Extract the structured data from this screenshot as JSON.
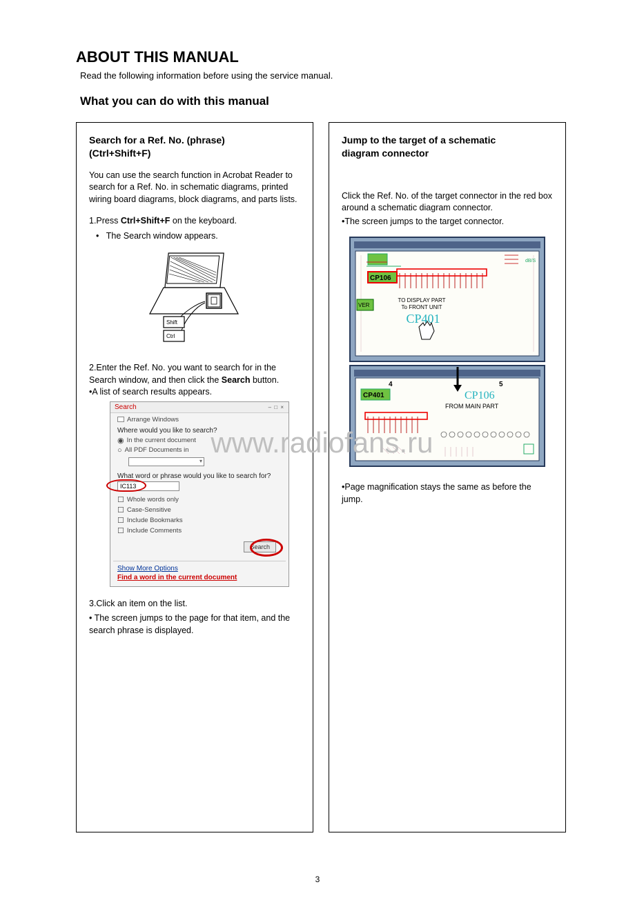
{
  "title": "ABOUT THIS MANUAL",
  "intro": "Read the following information before using the service manual.",
  "subtitle": "What you can do with this manual",
  "left": {
    "heading_l1": "Search for a Ref. No. (phrase)",
    "heading_l2": "(Ctrl+Shift+F)",
    "para1": "You can use the search function in Acrobat Reader to search for a Ref. No. in schematic diagrams, printed wiring board diagrams, block diagrams, and parts lists.",
    "step1_a": "1.Press ",
    "step1_b": "Ctrl+Shift+F",
    "step1_c": " on the keyboard.",
    "step1_bullet": "The Search window appears.",
    "laptop_key_top": "Shift",
    "laptop_key_bottom": "Ctrl",
    "step2a": "2.Enter the Ref. No. you want to search for in the Search window, and then click the ",
    "step2b": "Search",
    "step2c": " button.",
    "step2_bullet": "•A list of search results appears.",
    "searchbox": {
      "title": "Search",
      "arrange": "Arrange Windows",
      "where": "Where would you like to search?",
      "opt_current": "In the current document",
      "opt_all": "All PDF Documents in",
      "dd_arrow": "▾",
      "what": "What word or phrase would you like to search for?",
      "input_value": "IC113",
      "cb1": "Whole words only",
      "cb2": "Case-Sensitive",
      "cb3": "Include Bookmarks",
      "cb4": "Include Comments",
      "btn": "Search",
      "link1": "Show More Options",
      "link2": "Find a word in the current document"
    },
    "step3": "3.Click an item on the list.",
    "step3_bullet": "• The screen jumps to the page for that item, and the search phrase is displayed."
  },
  "right": {
    "heading_l1": "Jump to the target of a schematic",
    "heading_l2": "diagram connector",
    "para1": "Click the Ref. No. of the target connector in the red box around a schematic diagram connector.",
    "bullet1": "•The screen jumps to the target connector.",
    "bullet2": "•Page magnification stays the same as before the jump.",
    "schem": {
      "cp106": "CP106",
      "ver": "VER",
      "to_display1": "TO DISPLAY PART",
      "to_display2": "To FRONT UNIT",
      "cp401_green": "CP401",
      "cp401_cyan": "CP401",
      "axis_4": "4",
      "axis_5": "5",
      "cp106_cyan": "CP106",
      "from_main": "FROM MAIN PART"
    }
  },
  "watermark": "www.radiofans.ru",
  "pagenum": "3"
}
